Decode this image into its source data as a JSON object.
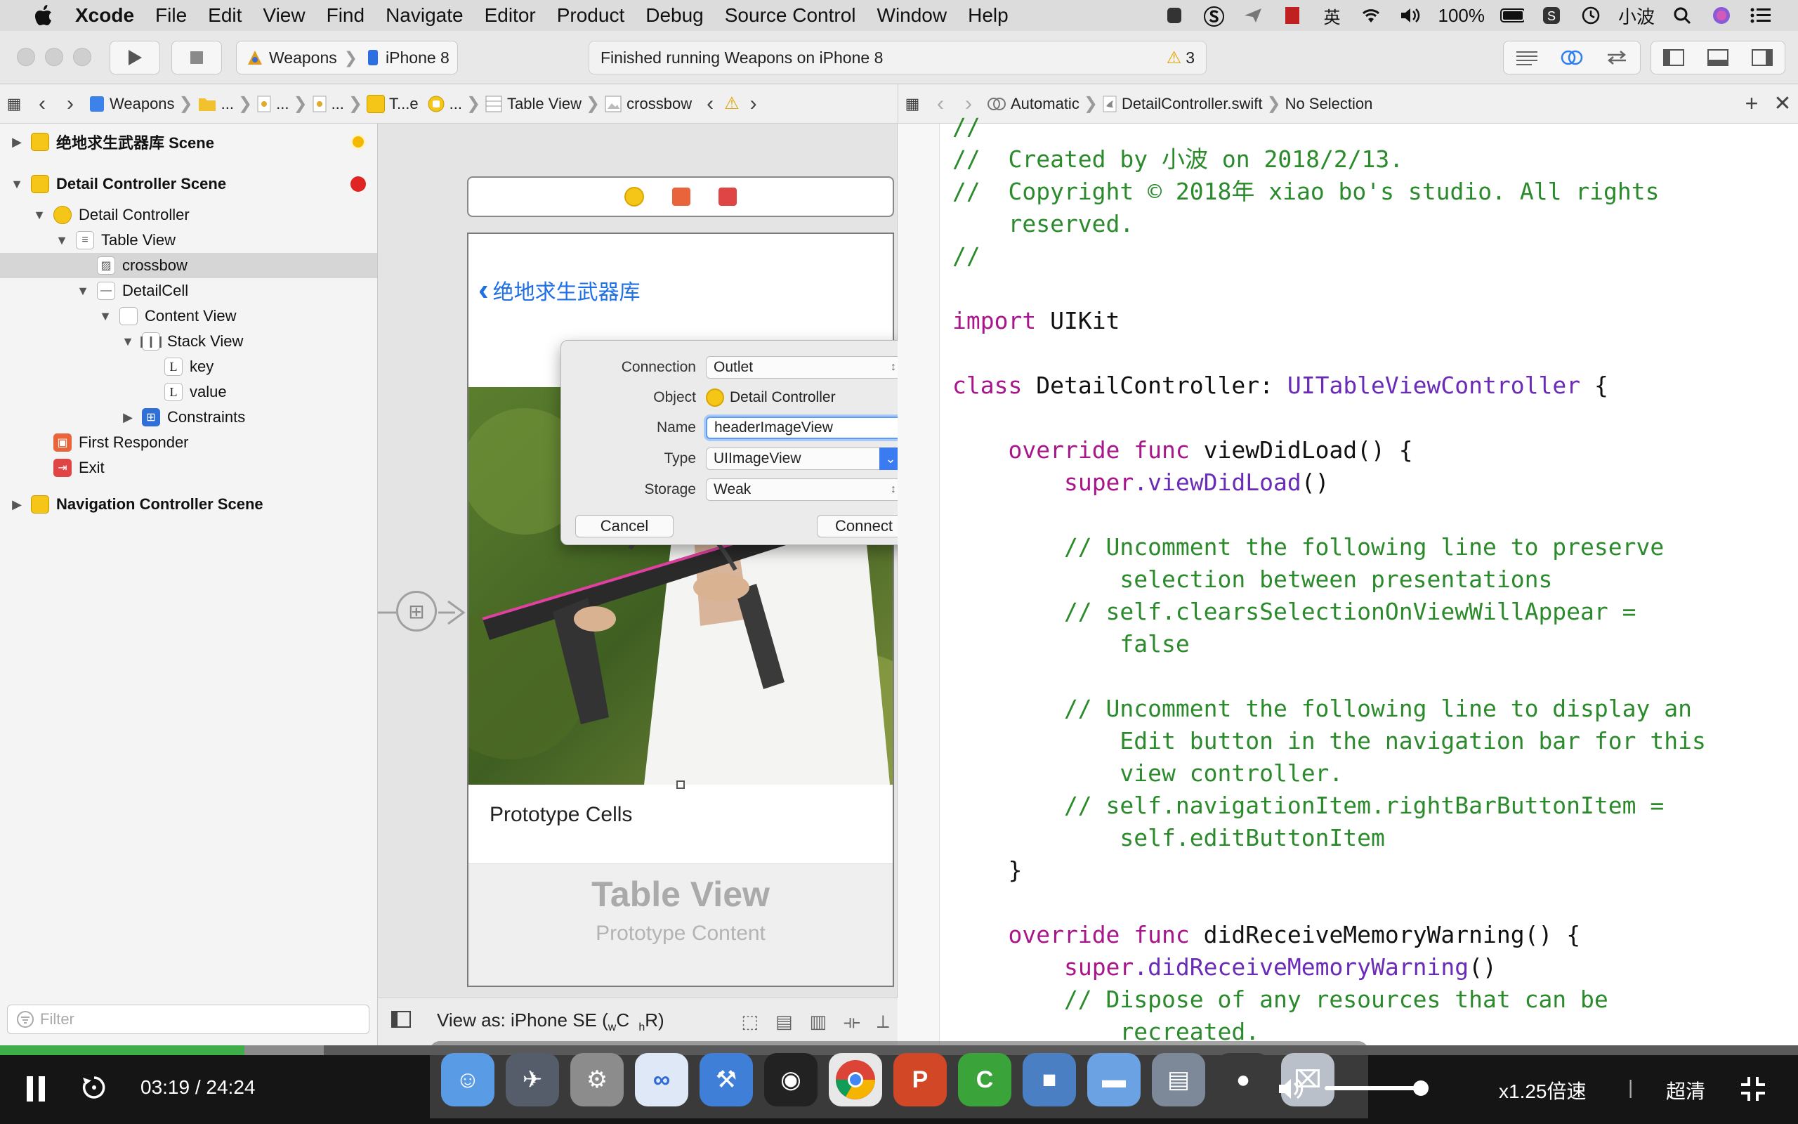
{
  "menubar": {
    "app_name": "Xcode",
    "items": [
      "File",
      "Edit",
      "View",
      "Find",
      "Navigate",
      "Editor",
      "Product",
      "Debug",
      "Source Control",
      "Window",
      "Help"
    ],
    "ime": "英",
    "battery": "100%",
    "user": "小波"
  },
  "toolbar": {
    "scheme": "Weapons",
    "device": "iPhone 8",
    "status": "Finished running Weapons on iPhone 8",
    "warning_count": "3"
  },
  "jumpbar_left": {
    "items": [
      "Weapons",
      "...",
      "...",
      "...",
      "T...e",
      "...",
      "Table View",
      "crossbow"
    ]
  },
  "jumpbar_right": {
    "mode": "Automatic",
    "file": "DetailController.swift",
    "selection": "No Selection"
  },
  "outline": {
    "scene1": "绝地求生武器库 Scene",
    "scene2": "Detail Controller Scene",
    "detail_controller": "Detail Controller",
    "table_view": "Table View",
    "crossbow": "crossbow",
    "detail_cell": "DetailCell",
    "content_view": "Content View",
    "stack_view": "Stack View",
    "key": "key",
    "value": "value",
    "constraints": "Constraints",
    "first_responder": "First Responder",
    "exit": "Exit",
    "scene3": "Navigation Controller Scene",
    "filter_placeholder": "Filter",
    "label_glyph": "L"
  },
  "canvas": {
    "nav_back_title": "绝地求生武器库",
    "prototype_cells": "Prototype Cells",
    "table_view_title": "Table View",
    "prototype_content": "Prototype Content",
    "view_as": "View as: iPhone SE (",
    "size_w": "w",
    "size_c": "C",
    "size_h": "h",
    "size_r": "R",
    "view_as_close": ")"
  },
  "popover": {
    "connection_label": "Connection",
    "connection_value": "Outlet",
    "object_label": "Object",
    "object_value": "Detail Controller",
    "name_label": "Name",
    "name_value": "headerImageView",
    "type_label": "Type",
    "type_value": "UIImageView",
    "storage_label": "Storage",
    "storage_value": "Weak",
    "cancel": "Cancel",
    "connect": "Connect"
  },
  "code_lines": [
    {
      "t": "com",
      "s": "//"
    },
    {
      "t": "com",
      "s": "//  Created by 小波 on 2018/2/13."
    },
    {
      "t": "com",
      "s": "//  Copyright © 2018年 xiao bo's studio. All rights"
    },
    {
      "t": "com",
      "s": "    reserved."
    },
    {
      "t": "com",
      "s": "//"
    },
    {
      "t": "plain",
      "s": ""
    },
    {
      "t": "import",
      "kw": "import",
      "rest": " UIKit"
    },
    {
      "t": "plain",
      "s": ""
    },
    {
      "t": "class",
      "kw": "class",
      "name": " DetailController: ",
      "type": "UITableViewController",
      "rest": " {"
    },
    {
      "t": "plain",
      "s": ""
    },
    {
      "t": "func",
      "indent": "    ",
      "kw": "override func",
      "rest": " viewDidLoad() {"
    },
    {
      "t": "super",
      "indent": "        ",
      "kw": "super",
      "fn": ".viewDidLoad",
      "rest": "()"
    },
    {
      "t": "plain",
      "s": ""
    },
    {
      "t": "com",
      "s": "        // Uncomment the following line to preserve"
    },
    {
      "t": "com",
      "s": "            selection between presentations"
    },
    {
      "t": "com",
      "s": "        // self.clearsSelectionOnViewWillAppear ="
    },
    {
      "t": "com",
      "s": "            false"
    },
    {
      "t": "plain",
      "s": ""
    },
    {
      "t": "com",
      "s": "        // Uncomment the following line to display an"
    },
    {
      "t": "com",
      "s": "            Edit button in the navigation bar for this"
    },
    {
      "t": "com",
      "s": "            view controller."
    },
    {
      "t": "com",
      "s": "        // self.navigationItem.rightBarButtonItem ="
    },
    {
      "t": "com",
      "s": "            self.editButtonItem"
    },
    {
      "t": "plain",
      "s": "    }"
    },
    {
      "t": "plain",
      "s": ""
    },
    {
      "t": "func",
      "indent": "    ",
      "kw": "override func",
      "rest": " didReceiveMemoryWarning() {"
    },
    {
      "t": "super",
      "indent": "        ",
      "kw": "super",
      "fn": ".didReceiveMemoryWarning",
      "rest": "()"
    },
    {
      "t": "com",
      "s": "        // Dispose of any resources that can be"
    },
    {
      "t": "com",
      "s": "            recreated."
    }
  ],
  "player": {
    "time": "03:19 / 24:24",
    "speed": "x1.25倍速",
    "separator": "|",
    "quality": "超清",
    "progress": 0.136,
    "buffered": 0.18,
    "volume": 0.85
  },
  "dock_apps": [
    "finder-icon",
    "launchpad-icon",
    "system-preferences-icon",
    "baidu-netdisk-icon",
    "xcode-icon",
    "qq-icon",
    "chrome-icon",
    "powerpoint-icon",
    "camtasia-icon",
    "simulator-icon",
    "folder-icon",
    "folder-icon",
    "recorder-icon",
    "trash-icon"
  ]
}
